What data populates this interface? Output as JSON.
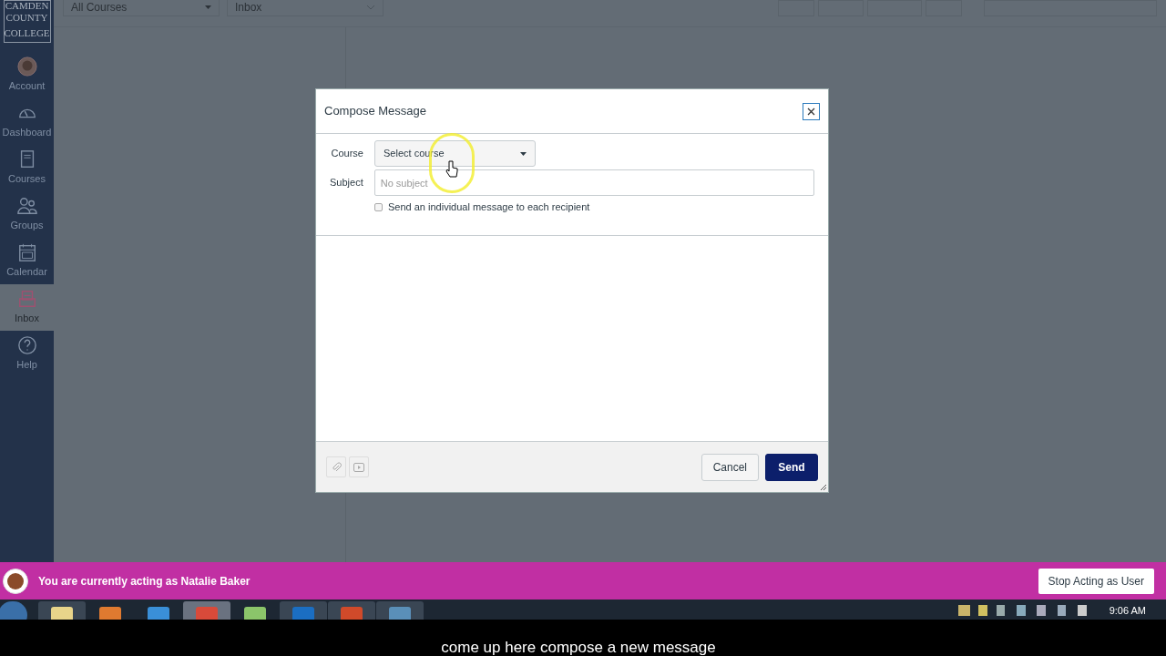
{
  "sidebar": {
    "logo_lines": [
      "CAMDEN",
      "COUNTY",
      "COLLEGE"
    ],
    "items": [
      {
        "label": "Account",
        "selected": false
      },
      {
        "label": "Dashboard",
        "selected": false
      },
      {
        "label": "Courses",
        "selected": false
      },
      {
        "label": "Groups",
        "selected": false
      },
      {
        "label": "Calendar",
        "selected": false
      },
      {
        "label": "Inbox",
        "selected": true
      },
      {
        "label": "Help",
        "selected": false
      }
    ]
  },
  "toolbar": {
    "course_filter": "All Courses",
    "mailbox_filter": "Inbox"
  },
  "dialog": {
    "title": "Compose Message",
    "course_label": "Course",
    "course_select": "Select course",
    "subject_label": "Subject",
    "subject_placeholder": "No subject",
    "individual_checkbox": {
      "label": "Send an individual message to each recipient",
      "checked": false
    },
    "buttons": [
      {
        "label": "Cancel",
        "kind": "secondary"
      },
      {
        "label": "Send",
        "kind": "primary"
      }
    ]
  },
  "banner": {
    "text": "You are currently acting as Natalie Baker",
    "button": "Stop Acting as User"
  },
  "taskbar": {
    "time": "9:06 AM"
  },
  "caption": "come up here compose a new message"
}
